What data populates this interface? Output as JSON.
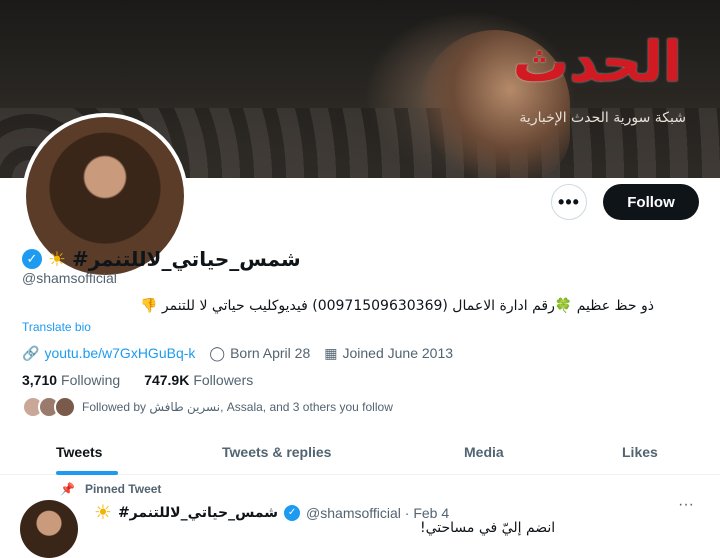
{
  "watermark": {
    "main": "الحدث",
    "sub": "شبكة سورية الحدث الإخبارية"
  },
  "profile": {
    "display_name": "#شمس_حياتي_لاللتنمر",
    "handle": "@shamsofficial",
    "bio": "ذو حظ عظيم 🍀رقم ادارة الاعمال (00971509630369)  فيديوكليب حياتي لا للتنمر 👎",
    "translate_label": "Translate bio",
    "link": "youtu.be/w7GxHGuBq-k",
    "born": "Born April 28",
    "joined": "Joined June 2013",
    "following_count": "3,710",
    "following_label": "Following",
    "followers_count": "747.9K",
    "followers_label": "Followers",
    "followed_by": "Followed by نسرين طافش, Assala, and 3 others you follow"
  },
  "actions": {
    "more": "•••",
    "follow_label": "Follow"
  },
  "tabs": [
    {
      "label": "Tweets",
      "active": true
    },
    {
      "label": "Tweets & replies",
      "active": false
    },
    {
      "label": "Media",
      "active": false
    },
    {
      "label": "Likes",
      "active": false
    }
  ],
  "pinned_tweet": {
    "pinned_label": "Pinned Tweet",
    "author_name": "#شمس_حياتي_لاللتنمر",
    "handle_date": "@shamsofficial · Feb 4",
    "more": "···",
    "text": "انضم إليّ في مساحتي!"
  },
  "colors": {
    "accent": "#1d9bf0",
    "text": "#0f1419",
    "muted": "#536471",
    "watermark": "#d11a22"
  }
}
